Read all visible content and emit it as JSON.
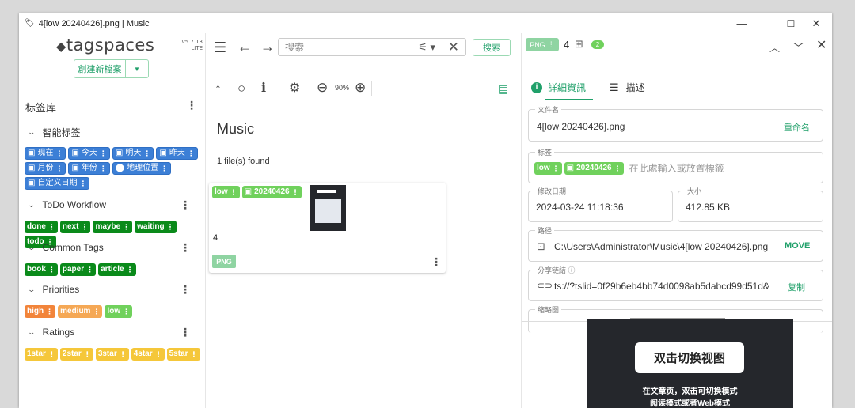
{
  "window": {
    "title": "4[low 20240426].png | Music",
    "minimize": "—",
    "maximize": "☐",
    "close": "✕"
  },
  "left": {
    "logo": "tagspaces",
    "version": "v5.7.13",
    "edition": "LITE",
    "new_file_button": "創建新檔案",
    "library_title": "标签库",
    "groups": [
      {
        "name": "智能标签",
        "tags": [
          "现在",
          "今天",
          "明天",
          "昨天",
          "月份",
          "年份",
          "地理位置",
          "自定义日期"
        ]
      },
      {
        "name": "ToDo Workflow",
        "tags": [
          "done",
          "next",
          "maybe",
          "waiting",
          "todo"
        ]
      },
      {
        "name": "Common Tags",
        "tags": [
          "book",
          "paper",
          "article"
        ]
      },
      {
        "name": "Priorities",
        "tags": [
          "high",
          "medium",
          "low"
        ]
      },
      {
        "name": "Ratings",
        "tags": [
          "1star",
          "2star",
          "3star",
          "4star",
          "5star"
        ]
      }
    ],
    "colors": {
      "smart": "#3c7fd6",
      "green": "#0a8a1a",
      "high": "#f2843a",
      "medium": "#f5a855",
      "low": "#70d15c",
      "rating": "#f5c73a"
    }
  },
  "mid": {
    "search_placeholder": "搜索",
    "search_button": "搜索",
    "zoom": "90%",
    "folder_name": "Music",
    "found_text": "1 file(s) found",
    "card": {
      "tags": [
        "low",
        "20240426"
      ],
      "name": "4",
      "ext": "PNG"
    }
  },
  "right": {
    "ext": "PNG",
    "name": "4",
    "count_badge": "2",
    "tab_details": "詳細資訊",
    "tab_desc": "描述",
    "filename_label": "文件名",
    "filename": "4[low 20240426].png",
    "rename": "重命名",
    "tags_label": "标签",
    "tags": [
      "low",
      "20240426"
    ],
    "tags_placeholder": "在此處輸入或放置標籤",
    "modified_label": "修改日期",
    "modified": "2024-03-24 11:18:36",
    "size_label": "大小",
    "size": "412.85 KB",
    "path_label": "路径",
    "path": "C:\\Users\\Administrator\\Music\\4[low 20240426].png",
    "move": "MOVE",
    "share_label": "分享链結",
    "share": "ts://?tslid=0f29b6eb4bb74d0098ab5dabcd99d51d&",
    "copy": "复制",
    "thumb_label": "缩略图",
    "preview": {
      "button": "双击切换视图",
      "line1": "在文章页，双击可切换模式",
      "line2": "阅读模式或者Web模式"
    }
  }
}
